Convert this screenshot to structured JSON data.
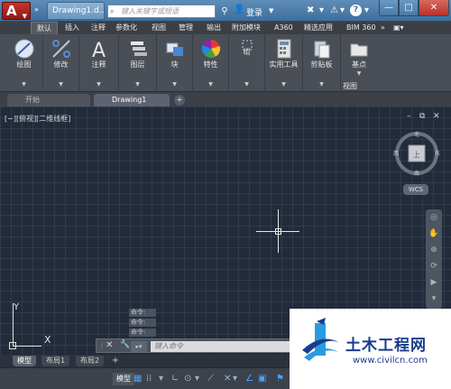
{
  "titlebar": {
    "app_letter": "A",
    "doc_title": "Drawing1.d...",
    "search_placeholder": "键入关键字或短语",
    "login": "登录",
    "help": "?"
  },
  "ribbon_tabs": [
    "默认",
    "插入",
    "注释",
    "参数化",
    "视图",
    "管理",
    "输出",
    "附加模块",
    "A360",
    "精选应用",
    "BIM 360"
  ],
  "ribbon_tabs_more": "»",
  "ribbon_buttons": {
    "draw": "绘图",
    "modify": "修改",
    "annotation": "注释",
    "layers": "图层",
    "block": "块",
    "properties": "特性",
    "group": "组",
    "utilities": "实用工具",
    "clipboard": "剪贴板",
    "basepoint": "基点"
  },
  "ribbon_view_label": "视图",
  "doc_tabs": {
    "start": "开始",
    "drawing": "Drawing1",
    "add": "+"
  },
  "viewport": {
    "label": "[−][俯视][二维线框]"
  },
  "viewcube": {
    "north": "北",
    "south": "南",
    "east": "东",
    "west": "西",
    "top": "上"
  },
  "wcs": "WCS",
  "ucs": {
    "x": "X",
    "y": "Y"
  },
  "command_history": [
    "命令:",
    "命令:",
    "命令:"
  ],
  "command": {
    "placeholder": "键入命令"
  },
  "layout_tabs": [
    "模型",
    "布局1",
    "布局2"
  ],
  "layout_add": "+",
  "status": {
    "model": "模型"
  },
  "watermark": {
    "title": "土木工程网",
    "url": "www.civilcn.com"
  },
  "colors": {
    "drawing_bg": "#212b3a",
    "ribbon_bg": "#4a4f57",
    "titlebar": "#3d6f9c",
    "accent_red": "#c8342c",
    "watermark_blue": "#1a3c8e"
  }
}
